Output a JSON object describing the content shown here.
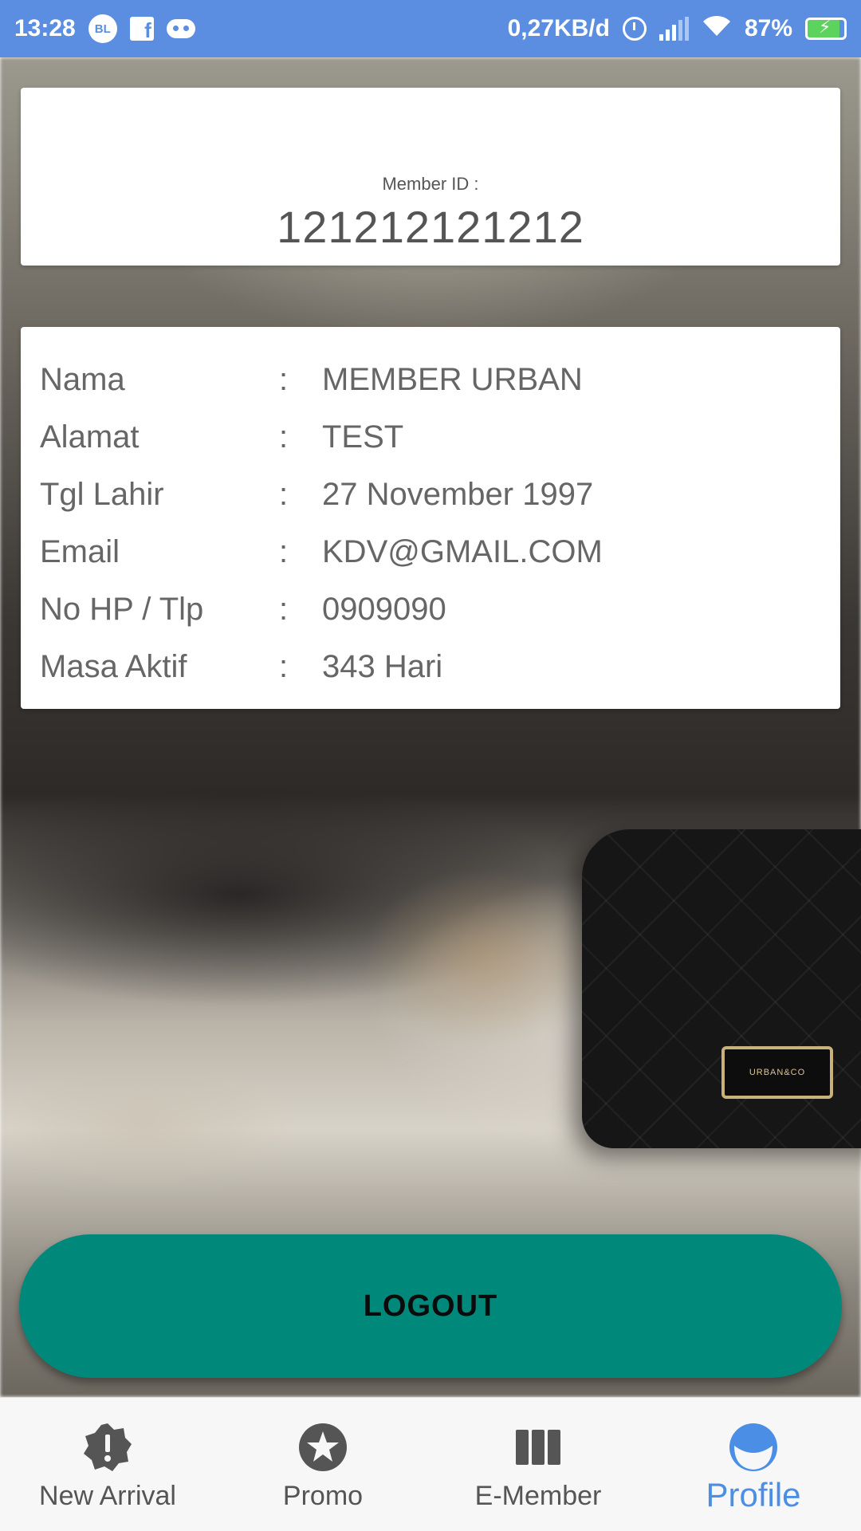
{
  "status_bar": {
    "time": "13:28",
    "badge_text": "BL",
    "facebook_glyph": "f",
    "network_speed": "0,27KB/d",
    "battery_percent": "87%",
    "battery_level": 0.87,
    "icons": [
      "bl-notification-icon",
      "facebook-icon",
      "game-controller-icon",
      "alarm-icon",
      "signal-icon",
      "wifi-icon",
      "battery-charging-icon"
    ]
  },
  "member_card": {
    "label": "Member ID :",
    "value": "121212121212"
  },
  "profile": {
    "separator": ":",
    "rows": [
      {
        "label": "Nama",
        "value": "MEMBER URBAN"
      },
      {
        "label": "Alamat",
        "value": "TEST"
      },
      {
        "label": "Tgl Lahir",
        "value": "27 November 1997"
      },
      {
        "label": "Email",
        "value": "KDV@GMAIL.COM"
      },
      {
        "label": "No HP / Tlp",
        "value": "0909090"
      },
      {
        "label": "Masa Aktif",
        "value": "343 Hari"
      }
    ]
  },
  "background": {
    "bag_logo": "URBAN&CO"
  },
  "actions": {
    "logout_label": "LOGOUT",
    "logout_color": "#00897b"
  },
  "bottom_nav": {
    "active_color": "#4a8ee6",
    "items": [
      {
        "label": "New Arrival",
        "icon": "alert-badge-icon"
      },
      {
        "label": "Promo",
        "icon": "star-circle-icon"
      },
      {
        "label": "E-Member",
        "icon": "columns-icon"
      },
      {
        "label": "Profile",
        "icon": "face-icon",
        "active": true
      }
    ]
  },
  "theme": {
    "status_bar_color": "#5b8de0"
  }
}
